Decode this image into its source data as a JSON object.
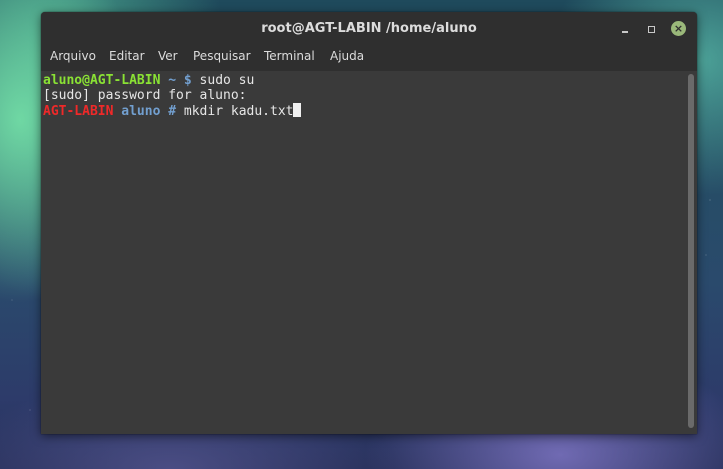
{
  "window": {
    "title": "root@AGT-LABIN /home/aluno",
    "close_glyph": "×"
  },
  "menu": {
    "items": [
      "Arquivo",
      "Editar",
      "Ver",
      "Pesquisar",
      "Terminal",
      "Ajuda"
    ]
  },
  "terminal": {
    "lines": [
      {
        "user_host": "aluno@AGT-LABIN",
        "path": "~",
        "prompt_symbol": "$",
        "command": "sudo su"
      },
      {
        "output": "[sudo] password for aluno:"
      },
      {
        "host": "AGT-LABIN",
        "user": "aluno",
        "prompt_symbol": "#",
        "command": "mkdir kadu.txt"
      }
    ]
  },
  "colors": {
    "prompt_user": "#8ae234",
    "prompt_path": "#729fcf",
    "root_host": "#ef2929",
    "terminal_bg": "#3a3a3a",
    "titlebar_bg": "#2f2f2f"
  }
}
